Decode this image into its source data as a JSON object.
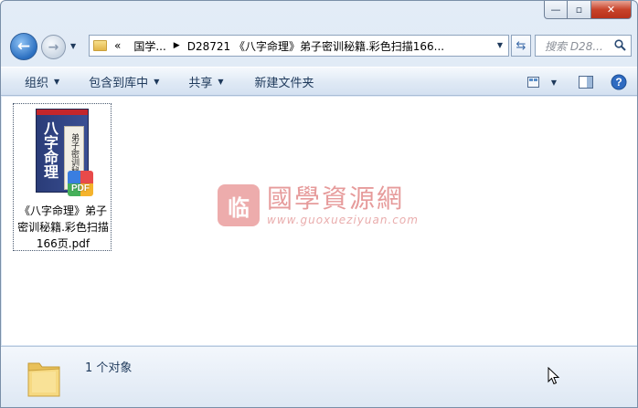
{
  "window": {
    "controls": {
      "minimize": "—",
      "maximize": "▫",
      "close": "✕"
    }
  },
  "nav": {
    "back": "←",
    "forward": "→",
    "breadcrumb": [
      {
        "label": "«"
      },
      {
        "label": "国学..."
      },
      {
        "label": "D28721 《八字命理》弟子密训秘籍.彩色扫描166..."
      }
    ],
    "search_placeholder": "搜索 D28..."
  },
  "commands": {
    "organize": "组织",
    "include_in_library": "包含到库中",
    "share": "共享",
    "new_folder": "新建文件夹"
  },
  "file": {
    "name": "《八字命理》弟子密训秘籍.彩色扫描166页.pdf",
    "thumb_title": "八字命理",
    "thumb_subtitle": "弟子密训秘籍",
    "badge": "PDF"
  },
  "watermark": {
    "logo_char": "临",
    "chinese": "國學資源網",
    "url": "www.guoxueziyuan.com"
  },
  "status": {
    "count_text": "1 个对象"
  },
  "colors": {
    "accent": "#1e395b",
    "close_red": "#c8432a",
    "folder_yellow": "#e2b64a"
  }
}
